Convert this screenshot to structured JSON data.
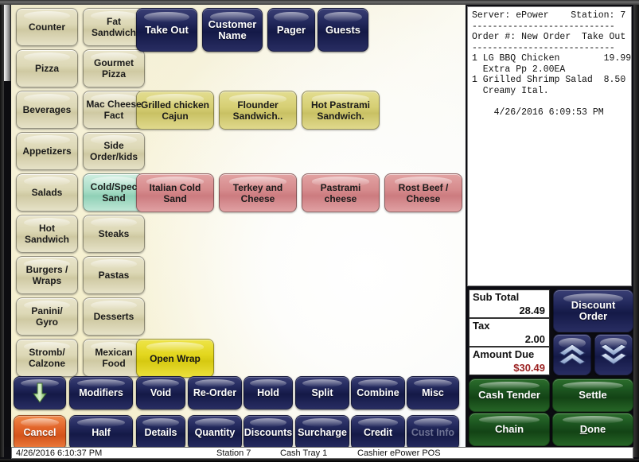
{
  "categories": [
    {
      "label": "Counter",
      "selected": false
    },
    {
      "label": "Fat Sandwich",
      "selected": false
    },
    {
      "label": "Pizza",
      "selected": false
    },
    {
      "label": "Gourmet Pizza",
      "selected": false
    },
    {
      "label": "Beverages",
      "selected": false
    },
    {
      "label": "Mac Cheese Fact",
      "selected": false
    },
    {
      "label": "Appetizers",
      "selected": false
    },
    {
      "label": "Side Order/kids",
      "selected": false
    },
    {
      "label": "Salads",
      "selected": false
    },
    {
      "label": "Cold/Spec Sand",
      "selected": true
    },
    {
      "label": "Hot Sandwich",
      "selected": false
    },
    {
      "label": "Steaks",
      "selected": false
    },
    {
      "label": "Burgers / Wraps",
      "selected": false
    },
    {
      "label": "Pastas",
      "selected": false
    },
    {
      "label": "Panini/ Gyro",
      "selected": false
    },
    {
      "label": "Desserts",
      "selected": false
    },
    {
      "label": "Stromb/ Calzone",
      "selected": false
    },
    {
      "label": "Mexican Food",
      "selected": false
    }
  ],
  "order_toolbar": [
    {
      "label": "Take Out"
    },
    {
      "label": "Customer Name"
    },
    {
      "label": "Pager"
    },
    {
      "label": "Guests"
    }
  ],
  "menu_items_row1": [
    {
      "label": "Grilled chicken Cajun"
    },
    {
      "label": "Flounder Sandwich.."
    },
    {
      "label": "Hot Pastrami Sandwich."
    }
  ],
  "menu_items_row2": [
    {
      "label": "Italian Cold Sand"
    },
    {
      "label": "Terkey and Cheese"
    },
    {
      "label": "Pastrami cheese"
    },
    {
      "label": "Rost Beef / Cheese"
    }
  ],
  "menu_items_row3": [
    {
      "label": "Open Wrap"
    }
  ],
  "function_row1": [
    {
      "label": "",
      "icon": "arrow-down-icon"
    },
    {
      "label": "Modifiers"
    },
    {
      "label": "Void"
    },
    {
      "label": "Re-Order"
    },
    {
      "label": "Hold"
    },
    {
      "label": "Split"
    },
    {
      "label": "Combine"
    },
    {
      "label": "Misc"
    }
  ],
  "function_row2": [
    {
      "label": "Cancel"
    },
    {
      "label": "Half"
    },
    {
      "label": "Details"
    },
    {
      "label": "Quantity"
    },
    {
      "label": "Discounts"
    },
    {
      "label": "Surcharge"
    },
    {
      "label": "Credit"
    },
    {
      "label": "Cust Info",
      "disabled": true
    }
  ],
  "receipt": {
    "header_line": "Server: ePower    Station: 7",
    "rule1": "----------------------------",
    "order_line": "Order #: New Order  Take Out",
    "rule2": "----------------------------",
    "lines": [
      "1 LG BBQ Chicken        19.99",
      "  Extra Pp 2.00EA",
      "1 Grilled Shrimp Salad  8.50",
      "  Creamy Ital."
    ],
    "timestamp": "    4/26/2016 6:09:53 PM"
  },
  "totals": {
    "subtotal_label": "Sub Total",
    "subtotal_value": "28.49",
    "tax_label": "Tax",
    "tax_value": "2.00",
    "due_label": "Amount Due",
    "due_value": "$30.49"
  },
  "side_actions": {
    "discount_order": "Discount Order",
    "scroll_up": "scroll-up-icon",
    "scroll_down": "scroll-down-icon"
  },
  "payment_buttons": [
    {
      "label": "Cash Tender"
    },
    {
      "label": "Settle"
    },
    {
      "label": "Chain"
    },
    {
      "label": "Done",
      "accel": "D"
    }
  ],
  "statusbar": {
    "datetime": "4/26/2016 6:10:37 PM",
    "station": "Station 7",
    "cash_tray": "Cash Tray 1",
    "cashier": "Cashier ePower POS"
  },
  "colors": {
    "navy": "#1c2258",
    "green": "#1c5520",
    "orange": "#de5f22",
    "selected_category": "#a8ddc7",
    "due_red": "#9b2222"
  }
}
